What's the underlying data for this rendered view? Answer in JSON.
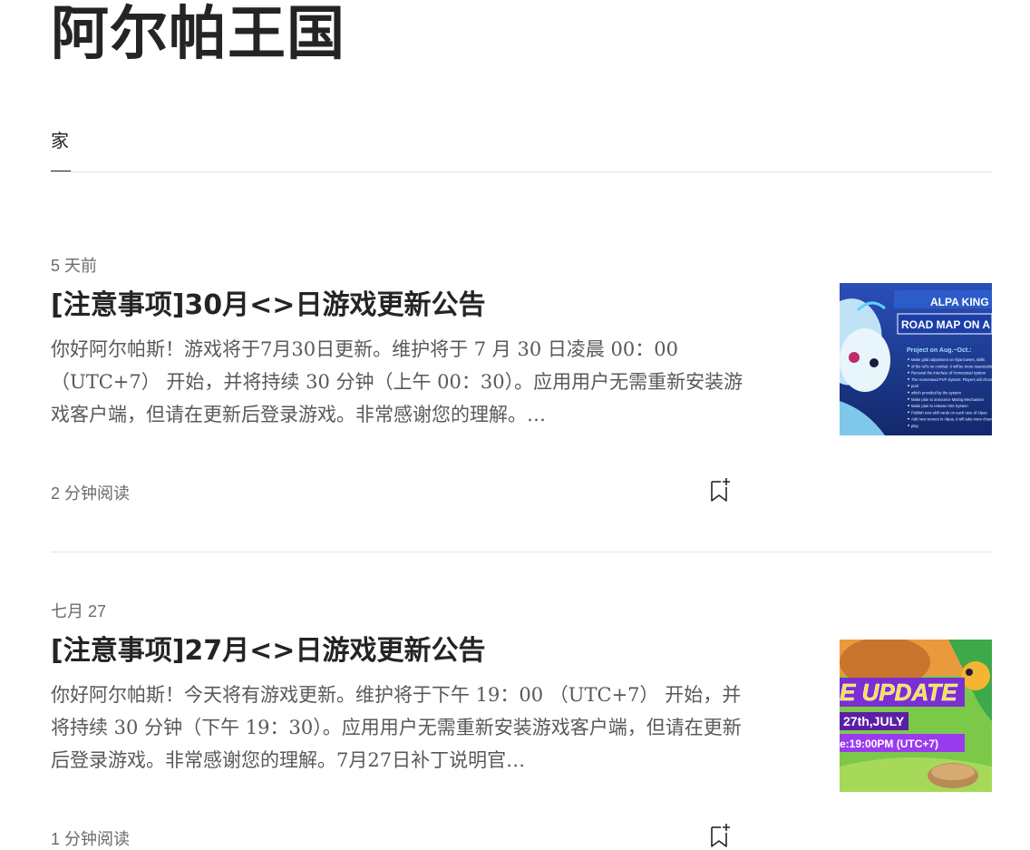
{
  "publication": {
    "title": "阿尔帕王国"
  },
  "nav": {
    "tabs": [
      {
        "label": "家"
      }
    ]
  },
  "articles": [
    {
      "date": "5 天前",
      "title": "[注意事项]30月<>日游戏更新公告",
      "excerpt": "你好阿尔帕斯！游戏将于7月30日更新。维护将于 7 月 30 日凌晨 00：00（UTC+7） 开始，并将持续 30 分钟（上午 00：30）。应用用户无需重新安装游戏客户端，但请在更新后登录游戏。非常感谢您的理解。…",
      "read_time": "2 分钟阅读",
      "thumbnail": {
        "heading": "ALPA KING",
        "subheading": "ROAD MAP ON A",
        "project_label": "Project on Aug.~Oct.:",
        "bullets": [
          "Make gold adjustment on Alpa towers, skills",
          "of the ref's on combat. It will be more reasonable",
          "Renewal the interface of Homestead system",
          "The Homestead PVP System: Players will choose Alpa",
          "pool",
          "which provided by the system",
          "Make plan to announce Mating Mechanism",
          "Make plan to release Hint System",
          "Publish new skill cards on each race of Alpas",
          "Add new scenes to Alpas, it will take more chance to",
          "play."
        ],
        "accent": "#1f6fd6"
      }
    },
    {
      "date": "七月 27",
      "title": "[注意事项]27月<>日游戏更新公告",
      "excerpt": "你好阿尔帕斯！今天将有游戏更新。维护将于下午 19：00 （UTC+7） 开始，并将持续 30 分钟（下午 19：30）。应用用户无需重新安装游戏客户端，但请在更新后登录游戏。非常感谢您的理解。7月27日补丁说明官…",
      "read_time": "1 分钟阅读",
      "thumbnail": {
        "heading": "E UPDATE",
        "date_text": "27th,JULY",
        "time_text": "e:19:00PM (UTC+7)",
        "accent": "#7b2fd0"
      }
    }
  ],
  "icons": {
    "bookmark": "bookmark-add-icon"
  },
  "colors": {
    "text": "#242424",
    "muted": "#6b6b6b",
    "excerpt": "#595959",
    "divider": "#e6e6e6"
  }
}
